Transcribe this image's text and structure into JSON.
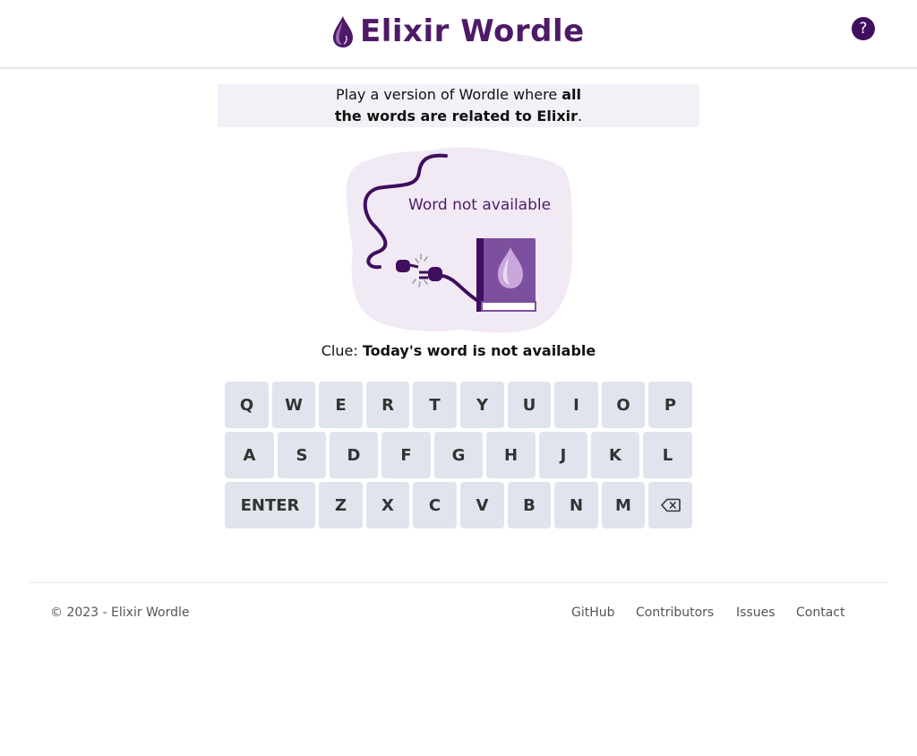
{
  "header": {
    "title": "Elixir Wordle",
    "help_label": "?"
  },
  "intro": {
    "text_before": "Play a version of Wordle where ",
    "bold_1": "all",
    "bold_2": "the words are related to Elixir",
    "period": "."
  },
  "status": {
    "illustration_text": "Word not available"
  },
  "clue": {
    "label": "Clue:",
    "value": "Today's word is not available"
  },
  "keyboard": {
    "row1": [
      "Q",
      "W",
      "E",
      "R",
      "T",
      "Y",
      "U",
      "I",
      "O",
      "P"
    ],
    "row2": [
      "A",
      "S",
      "D",
      "F",
      "G",
      "H",
      "J",
      "K",
      "L"
    ],
    "row3": [
      "ENTER",
      "Z",
      "X",
      "C",
      "V",
      "B",
      "N",
      "M"
    ],
    "backspace_icon": "backspace-icon"
  },
  "footer": {
    "copyright": "© 2023 - Elixir Wordle",
    "links": [
      "GitHub",
      "Contributors",
      "Issues",
      "Contact"
    ]
  },
  "colors": {
    "brand": "#4e1a68",
    "key_bg": "#e0e4ec",
    "intro_bg": "#f0f2f7",
    "blob": "#f1eaf5"
  }
}
